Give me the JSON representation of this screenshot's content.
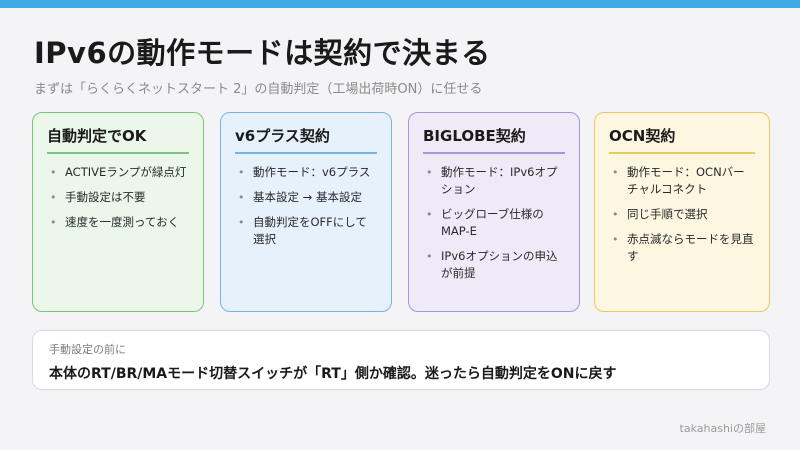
{
  "header": {
    "title": "IPv6の動作モードは契約で決まる",
    "subtitle": "まずは「らくらくネットスタート 2」の自動判定（工場出荷時ON）に任せる"
  },
  "cards": [
    {
      "title": "自動判定でOK",
      "items": [
        "ACTIVEランプが緑点灯",
        "手動設定は不要",
        "速度を一度測っておく"
      ]
    },
    {
      "title": "v6プラス契約",
      "items": [
        "動作モード：v6プラス",
        "基本設定 → 基本設定",
        "自動判定をOFFにして選択"
      ]
    },
    {
      "title": "BIGLOBE契約",
      "items": [
        "動作モード：IPv6オプション",
        "ビッグローブ仕様のMAP-E",
        "IPv6オプションの申込が前提"
      ]
    },
    {
      "title": "OCN契約",
      "items": [
        "動作モード：OCNバーチャルコネクト",
        "同じ手順で選択",
        "赤点滅ならモードを見直す"
      ]
    }
  ],
  "note": {
    "label": "手動設定の前に",
    "text": "本体のRT/BR/MAモード切替スイッチが「RT」側か確認。迷ったら自動判定をONに戻す"
  },
  "footer": {
    "credit": "takahashiの部屋"
  },
  "colors": {
    "accent_bar": "#3fa9e6",
    "green": "#7cc47a",
    "blue": "#78b4e3",
    "purple": "#a995d4",
    "yellow": "#ecc766"
  }
}
